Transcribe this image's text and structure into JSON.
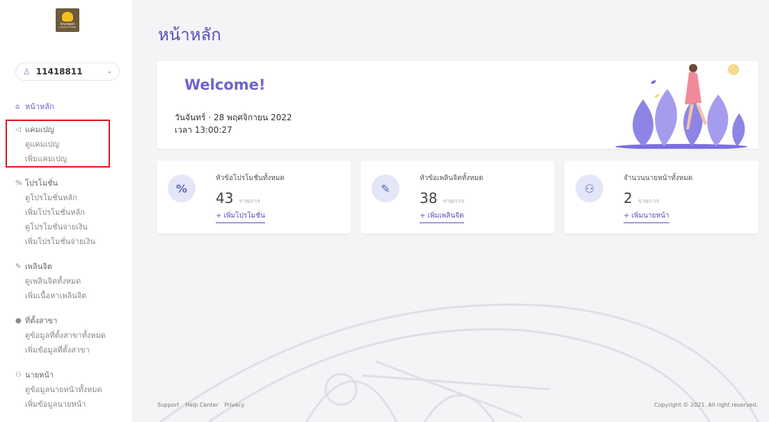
{
  "sidebar": {
    "logo": {
      "brand": "krungsri",
      "tagline": "a member of MUFG"
    },
    "user": {
      "id": "11418811"
    },
    "home": {
      "label": "หน้าหลัก"
    },
    "sections": [
      {
        "label": "แคมเปญ",
        "icon": "megaphone-icon",
        "items": [
          "ดูแคมเปญ",
          "เพิ่มแคมเปญ"
        ]
      },
      {
        "label": "โปรโมชั่น",
        "icon": "percent-icon",
        "items": [
          "ดูโปรโมชั่นหลัก",
          "เพิ่มโปรโมชั่นหลัก",
          "ดูโปรโมชั่นจ่ายเงิน",
          "เพิ่มโปรโมชั่นจ่ายเงิน"
        ]
      },
      {
        "label": "เพลินจิต",
        "icon": "edit-icon",
        "items": [
          "ดูเพลินจิตทั้งหมด",
          "เพิ่มเนื้อหาเพลินจิต"
        ]
      },
      {
        "label": "ที่ตั้งสาขา",
        "icon": "map-pin-icon",
        "items": [
          "ดูข้อมูลที่ตั้งสาขาทั้งหมด",
          "เพิ่มข้อมูลที่ตั้งสาขา"
        ]
      },
      {
        "label": "นายหน้า",
        "icon": "users-icon",
        "items": [
          "ดูข้อมูลนายหน้าทั้งหมด",
          "เพิ่มข้อมูลนายหน้า"
        ]
      }
    ]
  },
  "main": {
    "title": "หน้าหลัก",
    "welcome": {
      "title": "Welcome!",
      "date": "วันจันทร์ · 28 พฤศจิกายน 2022",
      "time": "เวลา 13:00:27"
    },
    "stats": [
      {
        "label": "หัวข้อโปรโมชั่นทั้งหมด",
        "value": "43",
        "unit": "รายการ",
        "link": "+ เพิ่มโปรโมชั่น",
        "icon": "percent-icon"
      },
      {
        "label": "หัวข้อเพลินจิตทั้งหมด",
        "value": "38",
        "unit": "รายการ",
        "link": "+ เพิ่มเพลินจิต",
        "icon": "edit-icon"
      },
      {
        "label": "จำนวนนายหน้าทั้งหมด",
        "value": "2",
        "unit": "รายการ",
        "link": "+ เพิ่มนายหน้า",
        "icon": "users-icon"
      }
    ]
  },
  "footer": {
    "links": [
      "Support",
      "Help Center",
      "Privacy"
    ],
    "copyright": "Copyright © 2021. All right reserved."
  },
  "colors": {
    "accent": "#5b50b8",
    "highlight": "#e0161b",
    "logo_bg": "#6b5b3a",
    "logo_mark": "#f2c21b"
  }
}
